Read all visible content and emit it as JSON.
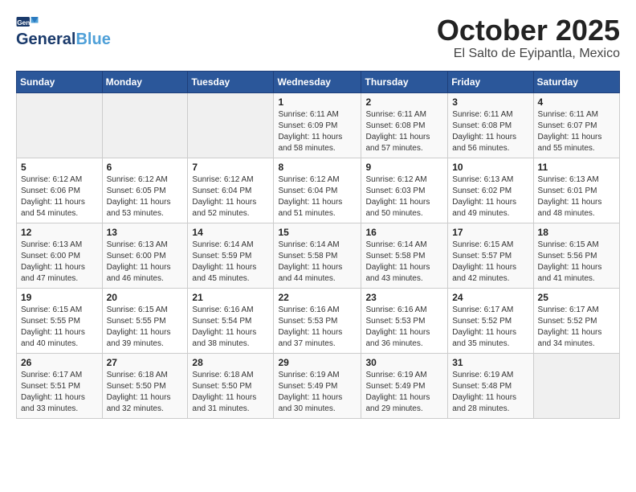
{
  "logo": {
    "part1": "General",
    "part2": "Blue"
  },
  "title": "October 2025",
  "subtitle": "El Salto de Eyipantla, Mexico",
  "days_of_week": [
    "Sunday",
    "Monday",
    "Tuesday",
    "Wednesday",
    "Thursday",
    "Friday",
    "Saturday"
  ],
  "weeks": [
    [
      {
        "day": "",
        "info": ""
      },
      {
        "day": "",
        "info": ""
      },
      {
        "day": "",
        "info": ""
      },
      {
        "day": "1",
        "info": "Sunrise: 6:11 AM\nSunset: 6:09 PM\nDaylight: 11 hours and 58 minutes."
      },
      {
        "day": "2",
        "info": "Sunrise: 6:11 AM\nSunset: 6:08 PM\nDaylight: 11 hours and 57 minutes."
      },
      {
        "day": "3",
        "info": "Sunrise: 6:11 AM\nSunset: 6:08 PM\nDaylight: 11 hours and 56 minutes."
      },
      {
        "day": "4",
        "info": "Sunrise: 6:11 AM\nSunset: 6:07 PM\nDaylight: 11 hours and 55 minutes."
      }
    ],
    [
      {
        "day": "5",
        "info": "Sunrise: 6:12 AM\nSunset: 6:06 PM\nDaylight: 11 hours and 54 minutes."
      },
      {
        "day": "6",
        "info": "Sunrise: 6:12 AM\nSunset: 6:05 PM\nDaylight: 11 hours and 53 minutes."
      },
      {
        "day": "7",
        "info": "Sunrise: 6:12 AM\nSunset: 6:04 PM\nDaylight: 11 hours and 52 minutes."
      },
      {
        "day": "8",
        "info": "Sunrise: 6:12 AM\nSunset: 6:04 PM\nDaylight: 11 hours and 51 minutes."
      },
      {
        "day": "9",
        "info": "Sunrise: 6:12 AM\nSunset: 6:03 PM\nDaylight: 11 hours and 50 minutes."
      },
      {
        "day": "10",
        "info": "Sunrise: 6:13 AM\nSunset: 6:02 PM\nDaylight: 11 hours and 49 minutes."
      },
      {
        "day": "11",
        "info": "Sunrise: 6:13 AM\nSunset: 6:01 PM\nDaylight: 11 hours and 48 minutes."
      }
    ],
    [
      {
        "day": "12",
        "info": "Sunrise: 6:13 AM\nSunset: 6:00 PM\nDaylight: 11 hours and 47 minutes."
      },
      {
        "day": "13",
        "info": "Sunrise: 6:13 AM\nSunset: 6:00 PM\nDaylight: 11 hours and 46 minutes."
      },
      {
        "day": "14",
        "info": "Sunrise: 6:14 AM\nSunset: 5:59 PM\nDaylight: 11 hours and 45 minutes."
      },
      {
        "day": "15",
        "info": "Sunrise: 6:14 AM\nSunset: 5:58 PM\nDaylight: 11 hours and 44 minutes."
      },
      {
        "day": "16",
        "info": "Sunrise: 6:14 AM\nSunset: 5:58 PM\nDaylight: 11 hours and 43 minutes."
      },
      {
        "day": "17",
        "info": "Sunrise: 6:15 AM\nSunset: 5:57 PM\nDaylight: 11 hours and 42 minutes."
      },
      {
        "day": "18",
        "info": "Sunrise: 6:15 AM\nSunset: 5:56 PM\nDaylight: 11 hours and 41 minutes."
      }
    ],
    [
      {
        "day": "19",
        "info": "Sunrise: 6:15 AM\nSunset: 5:55 PM\nDaylight: 11 hours and 40 minutes."
      },
      {
        "day": "20",
        "info": "Sunrise: 6:15 AM\nSunset: 5:55 PM\nDaylight: 11 hours and 39 minutes."
      },
      {
        "day": "21",
        "info": "Sunrise: 6:16 AM\nSunset: 5:54 PM\nDaylight: 11 hours and 38 minutes."
      },
      {
        "day": "22",
        "info": "Sunrise: 6:16 AM\nSunset: 5:53 PM\nDaylight: 11 hours and 37 minutes."
      },
      {
        "day": "23",
        "info": "Sunrise: 6:16 AM\nSunset: 5:53 PM\nDaylight: 11 hours and 36 minutes."
      },
      {
        "day": "24",
        "info": "Sunrise: 6:17 AM\nSunset: 5:52 PM\nDaylight: 11 hours and 35 minutes."
      },
      {
        "day": "25",
        "info": "Sunrise: 6:17 AM\nSunset: 5:52 PM\nDaylight: 11 hours and 34 minutes."
      }
    ],
    [
      {
        "day": "26",
        "info": "Sunrise: 6:17 AM\nSunset: 5:51 PM\nDaylight: 11 hours and 33 minutes."
      },
      {
        "day": "27",
        "info": "Sunrise: 6:18 AM\nSunset: 5:50 PM\nDaylight: 11 hours and 32 minutes."
      },
      {
        "day": "28",
        "info": "Sunrise: 6:18 AM\nSunset: 5:50 PM\nDaylight: 11 hours and 31 minutes."
      },
      {
        "day": "29",
        "info": "Sunrise: 6:19 AM\nSunset: 5:49 PM\nDaylight: 11 hours and 30 minutes."
      },
      {
        "day": "30",
        "info": "Sunrise: 6:19 AM\nSunset: 5:49 PM\nDaylight: 11 hours and 29 minutes."
      },
      {
        "day": "31",
        "info": "Sunrise: 6:19 AM\nSunset: 5:48 PM\nDaylight: 11 hours and 28 minutes."
      },
      {
        "day": "",
        "info": ""
      }
    ]
  ]
}
